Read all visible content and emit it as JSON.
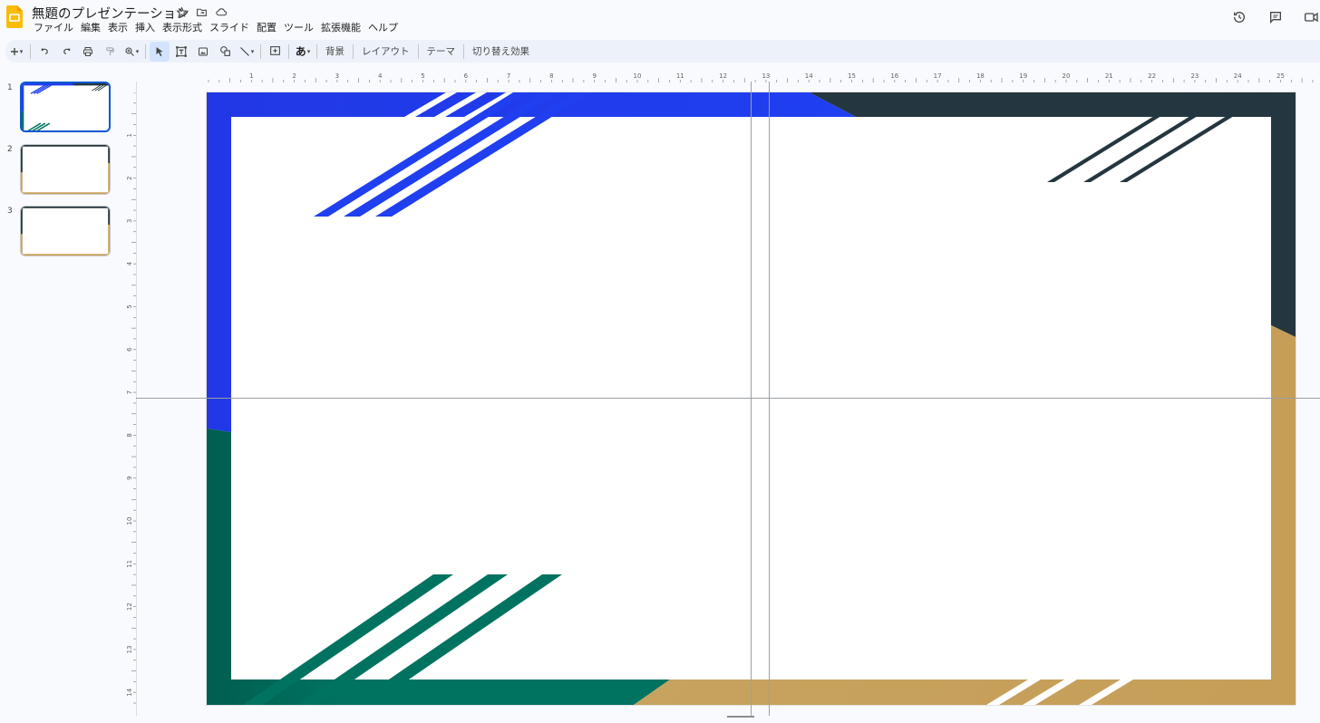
{
  "window": {
    "doc_title": "無題のプレゼンテーション"
  },
  "icons": {
    "app": "slides-logo-icon",
    "star": "star-icon",
    "move": "move-to-folder-icon",
    "cloud": "cloud-saved-icon",
    "history": "version-history-icon",
    "comments": "comments-icon",
    "meet": "meet-camera-icon"
  },
  "menu": [
    "ファイル",
    "編集",
    "表示",
    "挿入",
    "表示形式",
    "スライド",
    "配置",
    "ツール",
    "拡張機能",
    "ヘルプ"
  ],
  "toolbar": {
    "background": "背景",
    "layout": "レイアウト",
    "theme": "テーマ",
    "transition": "切り替え効果",
    "input_tools": "あ"
  },
  "filmstrip": {
    "slides": [
      {
        "number": "1",
        "active": true
      },
      {
        "number": "2",
        "active": false
      },
      {
        "number": "3",
        "active": false
      }
    ]
  },
  "ruler": {
    "horizontal": [
      "1",
      "2",
      "3",
      "4",
      "5",
      "6",
      "7",
      "8",
      "9",
      "10",
      "11",
      "12",
      "13",
      "14",
      "15",
      "16",
      "17",
      "18",
      "19",
      "20",
      "21",
      "22",
      "23",
      "24",
      "25"
    ],
    "vertical": [
      "1",
      "2",
      "3",
      "4",
      "5",
      "6",
      "7",
      "8",
      "9",
      "10",
      "11",
      "12",
      "13",
      "14"
    ]
  },
  "colors": {
    "blue": "#1f3ff0",
    "slate": "#24363f",
    "green": "#007360",
    "gold": "#c9a25d",
    "accent": "#0b57d0"
  }
}
